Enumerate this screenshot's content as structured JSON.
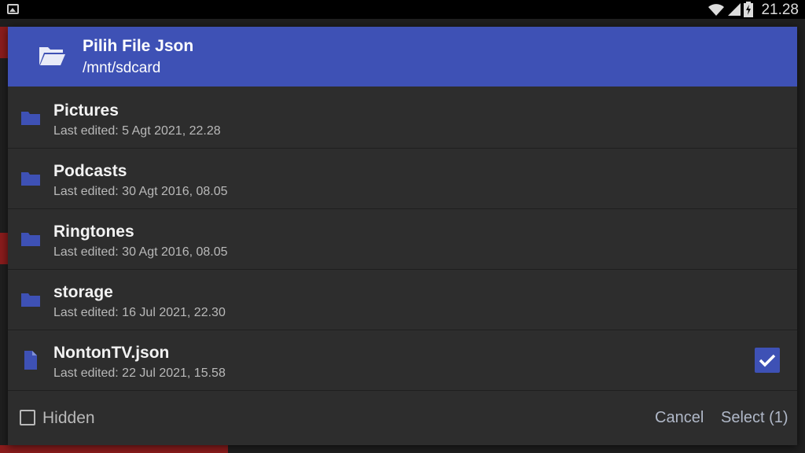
{
  "status_bar": {
    "time": "21.28",
    "icons": [
      "image-icon",
      "wifi-icon",
      "signal-icon",
      "battery-charging-icon"
    ]
  },
  "dialog": {
    "title": "Pilih File Json",
    "path": "/mnt/sdcard",
    "items": [
      {
        "name": "Pictures",
        "meta": "Last edited: 5 Agt 2021, 22.28",
        "type": "folder",
        "selected": false
      },
      {
        "name": "Podcasts",
        "meta": "Last edited: 30 Agt 2016, 08.05",
        "type": "folder",
        "selected": false
      },
      {
        "name": "Ringtones",
        "meta": "Last edited: 30 Agt 2016, 08.05",
        "type": "folder",
        "selected": false
      },
      {
        "name": "storage",
        "meta": "Last edited: 16 Jul 2021, 22.30",
        "type": "folder",
        "selected": false
      },
      {
        "name": "NontonTV.json",
        "meta": "Last edited: 22 Jul 2021, 15.58",
        "type": "file",
        "selected": true
      }
    ],
    "hidden_label": "Hidden",
    "hidden_checked": false,
    "cancel_label": "Cancel",
    "select_label": "Select (1)"
  },
  "colors": {
    "accent": "#3e51b5",
    "dialog_bg": "#2d2d2d",
    "status_bg": "#000000"
  }
}
